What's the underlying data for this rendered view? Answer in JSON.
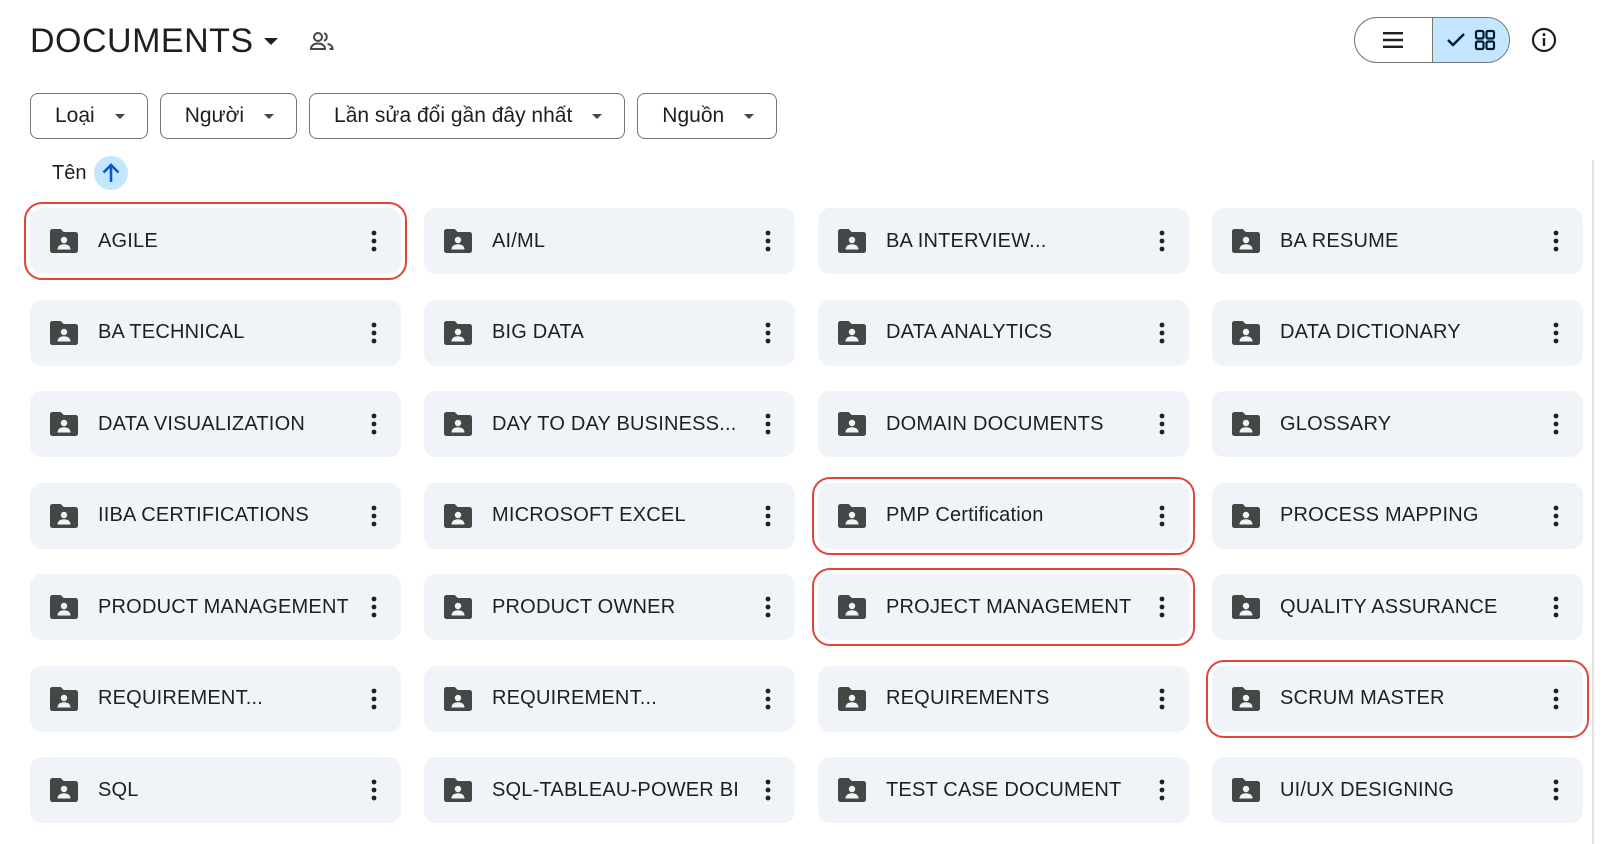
{
  "header": {
    "title": "DOCUMENTS"
  },
  "filters": [
    "Loại",
    "Người",
    "Lần sửa đổi gần đây nhất",
    "Nguồn"
  ],
  "sort": {
    "label": "Tên",
    "direction": "ascending"
  },
  "view": {
    "mode": "grid"
  },
  "colors": {
    "folder_bg": "#f0f4f9",
    "active_toggle": "#c2e7ff",
    "highlight": "#e0453a"
  },
  "folders": [
    {
      "name": "AGILE",
      "highlighted": true
    },
    {
      "name": "AI/ML",
      "highlighted": false
    },
    {
      "name": "BA INTERVIEW...",
      "highlighted": false
    },
    {
      "name": "BA RESUME",
      "highlighted": false
    },
    {
      "name": "BA TECHNICAL",
      "highlighted": false
    },
    {
      "name": "BIG DATA",
      "highlighted": false
    },
    {
      "name": "DATA ANALYTICS",
      "highlighted": false
    },
    {
      "name": "DATA DICTIONARY",
      "highlighted": false
    },
    {
      "name": "DATA VISUALIZATION",
      "highlighted": false
    },
    {
      "name": "DAY TO DAY BUSINESS...",
      "highlighted": false
    },
    {
      "name": "DOMAIN DOCUMENTS",
      "highlighted": false
    },
    {
      "name": "GLOSSARY",
      "highlighted": false
    },
    {
      "name": "IIBA CERTIFICATIONS",
      "highlighted": false
    },
    {
      "name": "MICROSOFT EXCEL",
      "highlighted": false
    },
    {
      "name": "PMP Certification",
      "highlighted": true
    },
    {
      "name": "PROCESS MAPPING",
      "highlighted": false
    },
    {
      "name": "PRODUCT MANAGEMENT",
      "highlighted": false
    },
    {
      "name": "PRODUCT OWNER",
      "highlighted": false
    },
    {
      "name": "PROJECT MANAGEMENT",
      "highlighted": true
    },
    {
      "name": "QUALITY ASSURANCE",
      "highlighted": false
    },
    {
      "name": "REQUIREMENT...",
      "highlighted": false
    },
    {
      "name": "REQUIREMENT...",
      "highlighted": false
    },
    {
      "name": "REQUIREMENTS",
      "highlighted": false
    },
    {
      "name": "SCRUM MASTER",
      "highlighted": true
    },
    {
      "name": "SQL",
      "highlighted": false
    },
    {
      "name": "SQL-TABLEAU-POWER BI",
      "highlighted": false
    },
    {
      "name": "TEST CASE DOCUMENT",
      "highlighted": false
    },
    {
      "name": "UI/UX DESIGNING",
      "highlighted": false
    }
  ]
}
